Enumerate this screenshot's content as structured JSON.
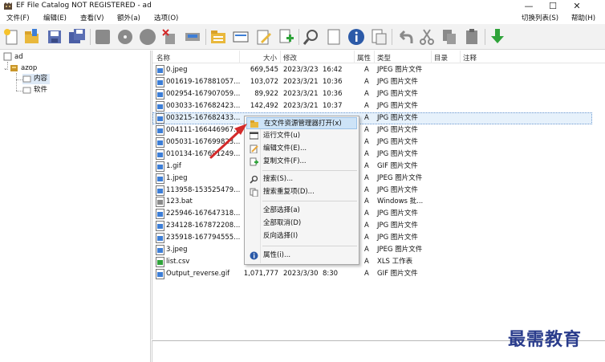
{
  "window": {
    "title": "EF File Catalog NOT REGISTERED - ad",
    "minimize": "—",
    "maximize": "☐",
    "close": "✕"
  },
  "menu": {
    "items": [
      "文件(F)",
      "编辑(E)",
      "查看(V)",
      "额外(a)",
      "选项(O)"
    ],
    "right_items": [
      "切换列表(S)",
      "帮助(H)"
    ]
  },
  "toolbar": {
    "icons": [
      "new-catalog-icon",
      "open-folder-icon",
      "save-icon",
      "save-all-icon",
      "grey-block-icon",
      "disc-icon",
      "circle-icon",
      "delete-tool-icon",
      "scanner-icon",
      "folder-list-icon",
      "card-icon",
      "edit-pencil-icon",
      "add-file-icon",
      "search-icon",
      "blank-page-icon",
      "info-icon",
      "copy-icon",
      "undo-icon",
      "scissors-icon",
      "copy-doc-icon",
      "paste-icon",
      "download-icon"
    ]
  },
  "tree": {
    "root": "ad",
    "child": "azop",
    "grandchildren": [
      "内容",
      "软件"
    ]
  },
  "list": {
    "headers": {
      "name": "名称",
      "size": "大小",
      "modified": "修改",
      "attr": "属性",
      "type": "类型",
      "dir": "目录",
      "comment": "注释"
    },
    "rows": [
      {
        "name": "0.jpeg",
        "size": "669,545",
        "date": "2023/3/23",
        "time": "16:42",
        "attr": "A",
        "type": "JPEG 图片文件",
        "icon": "image"
      },
      {
        "name": "001619-167881057...",
        "size": "103,072",
        "date": "2023/3/21",
        "time": "10:36",
        "attr": "A",
        "type": "JPG 图片文件",
        "icon": "image"
      },
      {
        "name": "002954-167907059...",
        "size": "89,922",
        "date": "2023/3/21",
        "time": "10:36",
        "attr": "A",
        "type": "JPG 图片文件",
        "icon": "image"
      },
      {
        "name": "003033-167682423...",
        "size": "142,492",
        "date": "2023/3/21",
        "time": "10:37",
        "attr": "A",
        "type": "JPG 图片文件",
        "icon": "image"
      },
      {
        "name": "003215-167682433...",
        "size": "",
        "date": "",
        "time": "",
        "attr": "A",
        "type": "JPG 图片文件",
        "icon": "image",
        "selected": true
      },
      {
        "name": "004111-166446967...",
        "size": "",
        "date": "",
        "time": "",
        "attr": "A",
        "type": "JPG 图片文件",
        "icon": "image"
      },
      {
        "name": "005031-167699823...",
        "size": "",
        "date": "",
        "time": "",
        "attr": "A",
        "type": "JPG 图片文件",
        "icon": "image"
      },
      {
        "name": "010134-167691249...",
        "size": "",
        "date": "",
        "time": "",
        "attr": "A",
        "type": "JPG 图片文件",
        "icon": "image"
      },
      {
        "name": "1.gif",
        "size": "",
        "date": "",
        "time": "",
        "attr": "A",
        "type": "GIF 图片文件",
        "icon": "image"
      },
      {
        "name": "1.jpeg",
        "size": "",
        "date": "",
        "time": "",
        "attr": "A",
        "type": "JPEG 图片文件",
        "icon": "image"
      },
      {
        "name": "113958-153525479...",
        "size": "",
        "date": "",
        "time": "",
        "attr": "A",
        "type": "JPG 图片文件",
        "icon": "image"
      },
      {
        "name": "123.bat",
        "size": "",
        "date": "",
        "time": "",
        "attr": "A",
        "type": "Windows 批...",
        "icon": "bat"
      },
      {
        "name": "225946-167647318...",
        "size": "",
        "date": "",
        "time": "",
        "attr": "A",
        "type": "JPG 图片文件",
        "icon": "image"
      },
      {
        "name": "234128-167872208...",
        "size": "",
        "date": "",
        "time": "",
        "attr": "A",
        "type": "JPG 图片文件",
        "icon": "image"
      },
      {
        "name": "235918-167794555...",
        "size": "",
        "date": "",
        "time": "",
        "attr": "A",
        "type": "JPG 图片文件",
        "icon": "image"
      },
      {
        "name": "3.jpeg",
        "size": "",
        "date": "",
        "time": "",
        "attr": "A",
        "type": "JPEG 图片文件",
        "icon": "image"
      },
      {
        "name": "list.csv",
        "size": "",
        "date": "",
        "time": "",
        "attr": "A",
        "type": "XLS 工作表",
        "icon": "csv"
      },
      {
        "name": "Output_reverse.gif",
        "size": "1,071,777",
        "date": "2023/3/30",
        "time": "8:30",
        "attr": "A",
        "type": "GIF 图片文件",
        "icon": "image"
      }
    ]
  },
  "context_menu": {
    "items": [
      {
        "label": "在文件资源管理器打开(x)",
        "icon": "explorer-open-icon",
        "highlighted": true
      },
      {
        "label": "运行文件(u)",
        "icon": "run-icon"
      },
      {
        "label": "编辑文件(E)...",
        "icon": "edit-icon"
      },
      {
        "label": "复制文件(F)...",
        "icon": "copy-file-icon"
      },
      {
        "label": "搜索(S)...",
        "icon": "search-icon"
      },
      {
        "label": "搜索重复项(D)...",
        "icon": "duplicate-icon"
      },
      {
        "label": "全部选择(a)",
        "icon": ""
      },
      {
        "label": "全部取消(D)",
        "icon": ""
      },
      {
        "label": "反向选择(I)",
        "icon": ""
      },
      {
        "label": "属性(i)...",
        "icon": "info-icon"
      }
    ]
  },
  "watermark": "最需教育",
  "colors": {
    "selection": "#e6f1fb",
    "menu_highlight": "#cde3f7",
    "arrow": "#d42a2a",
    "watermark": "#2a3c8c"
  }
}
